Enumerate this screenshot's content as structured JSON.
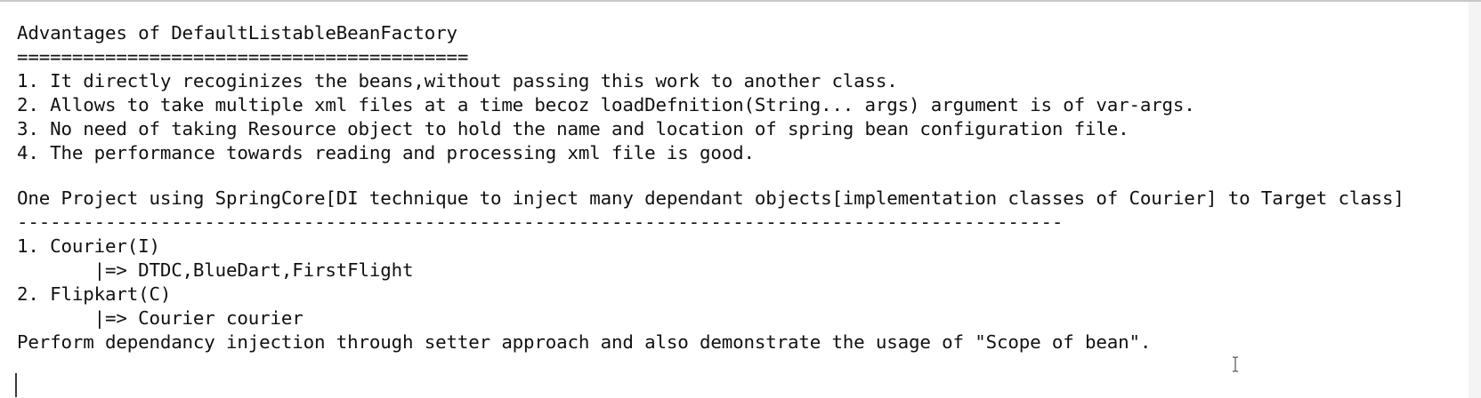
{
  "document": {
    "lines": [
      "Advantages of DefaultListableBeanFactory",
      "=========================================",
      "1. It directly recoginizes the beans,without passing this work to another class.",
      "2. Allows to take multiple xml files at a time becoz loadDefnition(String... args) argument is of var-args.",
      "3. No need of taking Resource object to hold the name and location of spring bean configuration file.",
      "4. The performance towards reading and processing xml file is good.",
      "One Project using SpringCore[DI technique to inject many dependant objects[implementation classes of Courier] to Target class]",
      "-----------------------------------------------------------------------------------------------",
      "1. Courier(I)",
      "       |=> DTDC,BlueDart,FirstFlight",
      "2. Flipkart(C)",
      "       |=> Courier courier",
      "Perform dependancy injection through setter approach and also demonstrate the usage of \"Scope of bean\"."
    ]
  },
  "icons": {
    "mouse_pointer": "ibeam-cursor-icon",
    "caret": "text-caret"
  },
  "colors": {
    "background": "#ffffff",
    "text": "#111111"
  }
}
